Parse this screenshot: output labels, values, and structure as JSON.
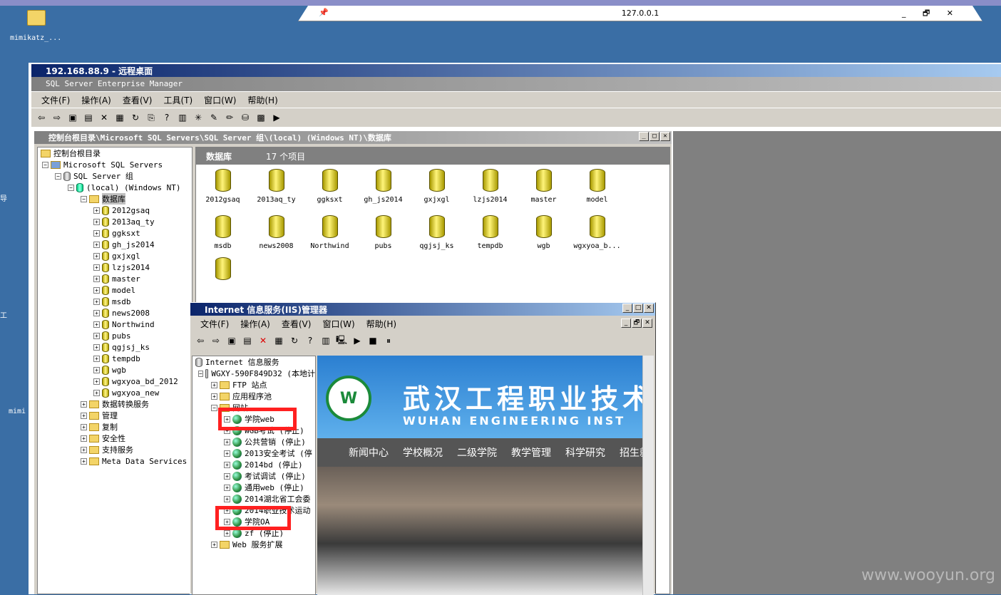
{
  "rdp_bar": {
    "title": "127.0.0.1",
    "controls": "_ 🗗 ✕"
  },
  "desktop": {
    "icon1_label": "mimikatz_...",
    "icon2_label": "mimi",
    "side_chars": [
      "导",
      "工"
    ]
  },
  "remote": {
    "title": "192.168.88.9 - 远程桌面"
  },
  "em": {
    "title": "SQL Server Enterprise Manager",
    "menu": [
      "文件(F)",
      "操作(A)",
      "查看(V)",
      "工具(T)",
      "窗口(W)",
      "帮助(H)"
    ],
    "child_title": "控制台根目录\\Microsoft SQL Servers\\SQL Server 组\\(local) (Windows NT)\\数据库",
    "tree": {
      "root": "控制台根目录",
      "servers": "Microsoft SQL Servers",
      "group": "SQL Server 组",
      "local": "(local) (Windows NT)",
      "databases": "数据库",
      "dbs": [
        "2012gsaq",
        "2013aq_ty",
        "ggksxt",
        "gh_js2014",
        "gxjxgl",
        "lzjs2014",
        "master",
        "model",
        "msdb",
        "news2008",
        "Northwind",
        "pubs",
        "qgjsj_ks",
        "tempdb",
        "wgb",
        "wgxyoa_bd_2012",
        "wgxyoa_new"
      ],
      "others": [
        "数据转换服务",
        "管理",
        "复制",
        "安全性",
        "支持服务",
        "Meta Data Services"
      ]
    },
    "pane_head": {
      "title": "数据库",
      "count": "17 个项目"
    },
    "grid": [
      "2012gsaq",
      "2013aq_ty",
      "ggksxt",
      "gh_js2014",
      "gxjxgl",
      "lzjs2014",
      "master",
      "model",
      "msdb",
      "news2008",
      "Northwind",
      "pubs",
      "qgjsj_ks",
      "tempdb",
      "wgb",
      "wgxyoa_b..."
    ]
  },
  "iis": {
    "title": "Internet 信息服务(IIS)管理器",
    "menu": [
      "文件(F)",
      "操作(A)",
      "查看(V)",
      "窗口(W)",
      "帮助(H)"
    ],
    "tree": {
      "root": "Internet 信息服务",
      "server": "WGXY-590F849D32 (本地计",
      "ftp": "FTP 站点",
      "apppool": "应用程序池",
      "website": "网站",
      "sites": [
        "学院web",
        "WGB考试 (停止)",
        "公共营销 (停止)",
        "2013安全考试 (停",
        "2014bd (停止)",
        "考试调试 (停止)",
        "通用web (停止)",
        "2014湖北省工会委",
        "2014职业技术运动",
        "学院OA",
        "zf (停止)"
      ],
      "ext": "Web 服务扩展"
    },
    "web": {
      "cn": "武汉工程职业技术",
      "en": "WUHAN ENGINEERING INST",
      "logo": "W",
      "nav": [
        "新闻中心",
        "学校概况",
        "二级学院",
        "教学管理",
        "科学研究",
        "招生就"
      ]
    }
  },
  "watermark": "www.wooyun.org"
}
